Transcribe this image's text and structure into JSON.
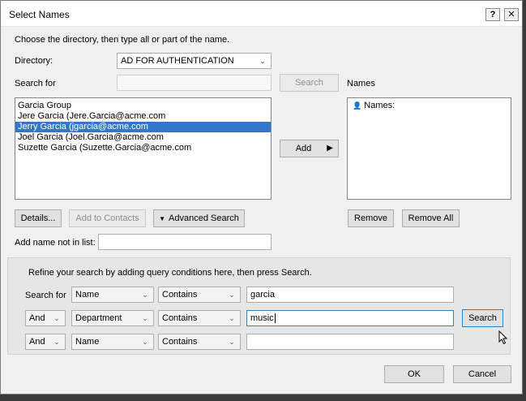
{
  "window": {
    "title": "Select Names",
    "help": "?",
    "close": "✕"
  },
  "instruction": "Choose the directory, then type all or part of the name.",
  "directory": {
    "label": "Directory:",
    "value": "AD FOR AUTHENTICATION"
  },
  "search": {
    "label": "Search for",
    "value": "",
    "button": "Search"
  },
  "names_panel": {
    "label": "Names",
    "header": "Names:"
  },
  "results": [
    {
      "text": "Garcia Group",
      "selected": false
    },
    {
      "text": "Jere Garcia (Jere.Garcia@acme.com",
      "selected": false
    },
    {
      "text": "Jerry Garcia (jgarcia@acme.com",
      "selected": true
    },
    {
      "text": "Joel Garcia (Joel.Garcia@acme.com",
      "selected": false
    },
    {
      "text": "Suzette Garcia (Suzette.Garcia@acme.com",
      "selected": false
    }
  ],
  "buttons": {
    "add": "Add",
    "details": "Details...",
    "add_to_contacts": "Add to Contacts",
    "advanced_search": "Advanced Search",
    "remove": "Remove",
    "remove_all": "Remove All",
    "ok": "OK",
    "cancel": "Cancel",
    "refine_search": "Search"
  },
  "add_name": {
    "label": "Add name not in list:",
    "value": ""
  },
  "refine": {
    "instruction": "Refine your search by adding query conditions here, then press Search.",
    "rows": [
      {
        "prefix": "Search for",
        "field": "Name",
        "operator": "Contains",
        "value": "garcia"
      },
      {
        "prefix": "And",
        "field": "Department",
        "operator": "Contains",
        "value": "music"
      },
      {
        "prefix": "And",
        "field": "Name",
        "operator": "Contains",
        "value": ""
      }
    ]
  },
  "icons": {
    "chevron": "chevron-down-icon",
    "arrow": "arrow-right-icon",
    "triangle": "triangle-down-icon",
    "names": "contact-icon"
  }
}
